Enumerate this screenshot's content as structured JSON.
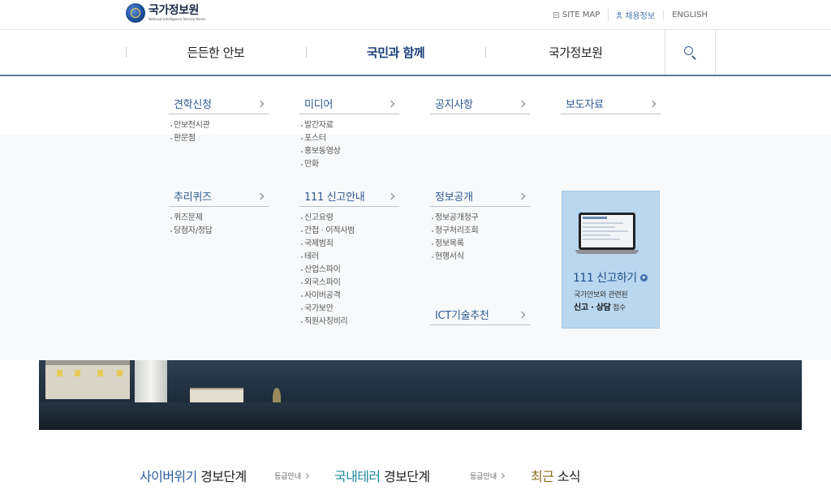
{
  "header": {
    "logo_title": "국가정보원",
    "logo_subtitle": "National Intelligence Service Korea",
    "utility_links": [
      {
        "label": "SITE MAP",
        "icon": "sitemap-icon"
      },
      {
        "label": "채용정보",
        "icon": "person-icon"
      },
      {
        "label": "ENGLISH"
      }
    ]
  },
  "nav": {
    "items": [
      "든든한 안보",
      "국민과 함께",
      "국가정보원"
    ],
    "active": "국민과 함께",
    "search_icon": "search-icon"
  },
  "mega_menu": {
    "columns": [
      {
        "title": "견학신청",
        "items": [
          "안보전시관",
          "판문점"
        ]
      },
      {
        "title": "미디어",
        "items": [
          "발간자료",
          "포스터",
          "홍보동영상",
          "만화"
        ]
      },
      {
        "title": "공지사항",
        "items": []
      },
      {
        "title": "보도자료",
        "items": []
      },
      {
        "title": "추리퀴즈",
        "items": [
          "퀴즈문제",
          "당첨자/정답"
        ]
      },
      {
        "title": "111 신고안내",
        "items": [
          "신고요령",
          "간첩 · 이적사범",
          "국제범죄",
          "테러",
          "산업스파이",
          "외국스파이",
          "사이버공격",
          "국가보안",
          "직원사칭비리"
        ]
      },
      {
        "title": "정보공개",
        "items": [
          "정보공개청구",
          "청구처리조회",
          "정보목록",
          "현행서식"
        ]
      },
      {
        "title": "ICT기술추천",
        "items": []
      }
    ],
    "promo": {
      "title": "111 신고하기",
      "desc_line1": "국가안보와 관련된",
      "desc_bold": "신고 · 상담",
      "desc_tail": "접수",
      "bg_color": "#b9d7ef"
    }
  },
  "bottom": {
    "sections": [
      {
        "highlight": "사이버위기",
        "rest": " 경보단계",
        "link": "등급안내"
      },
      {
        "highlight": "국내테러",
        "rest": " 경보단계",
        "link": "등급안내"
      },
      {
        "highlight": "최근",
        "rest": " 소식"
      }
    ]
  },
  "colors": {
    "accent_blue": "#2b5c9e",
    "accent_teal": "#1f8a9a",
    "accent_gold": "#8a6d1e",
    "nav_line": "#5e7aa0"
  }
}
